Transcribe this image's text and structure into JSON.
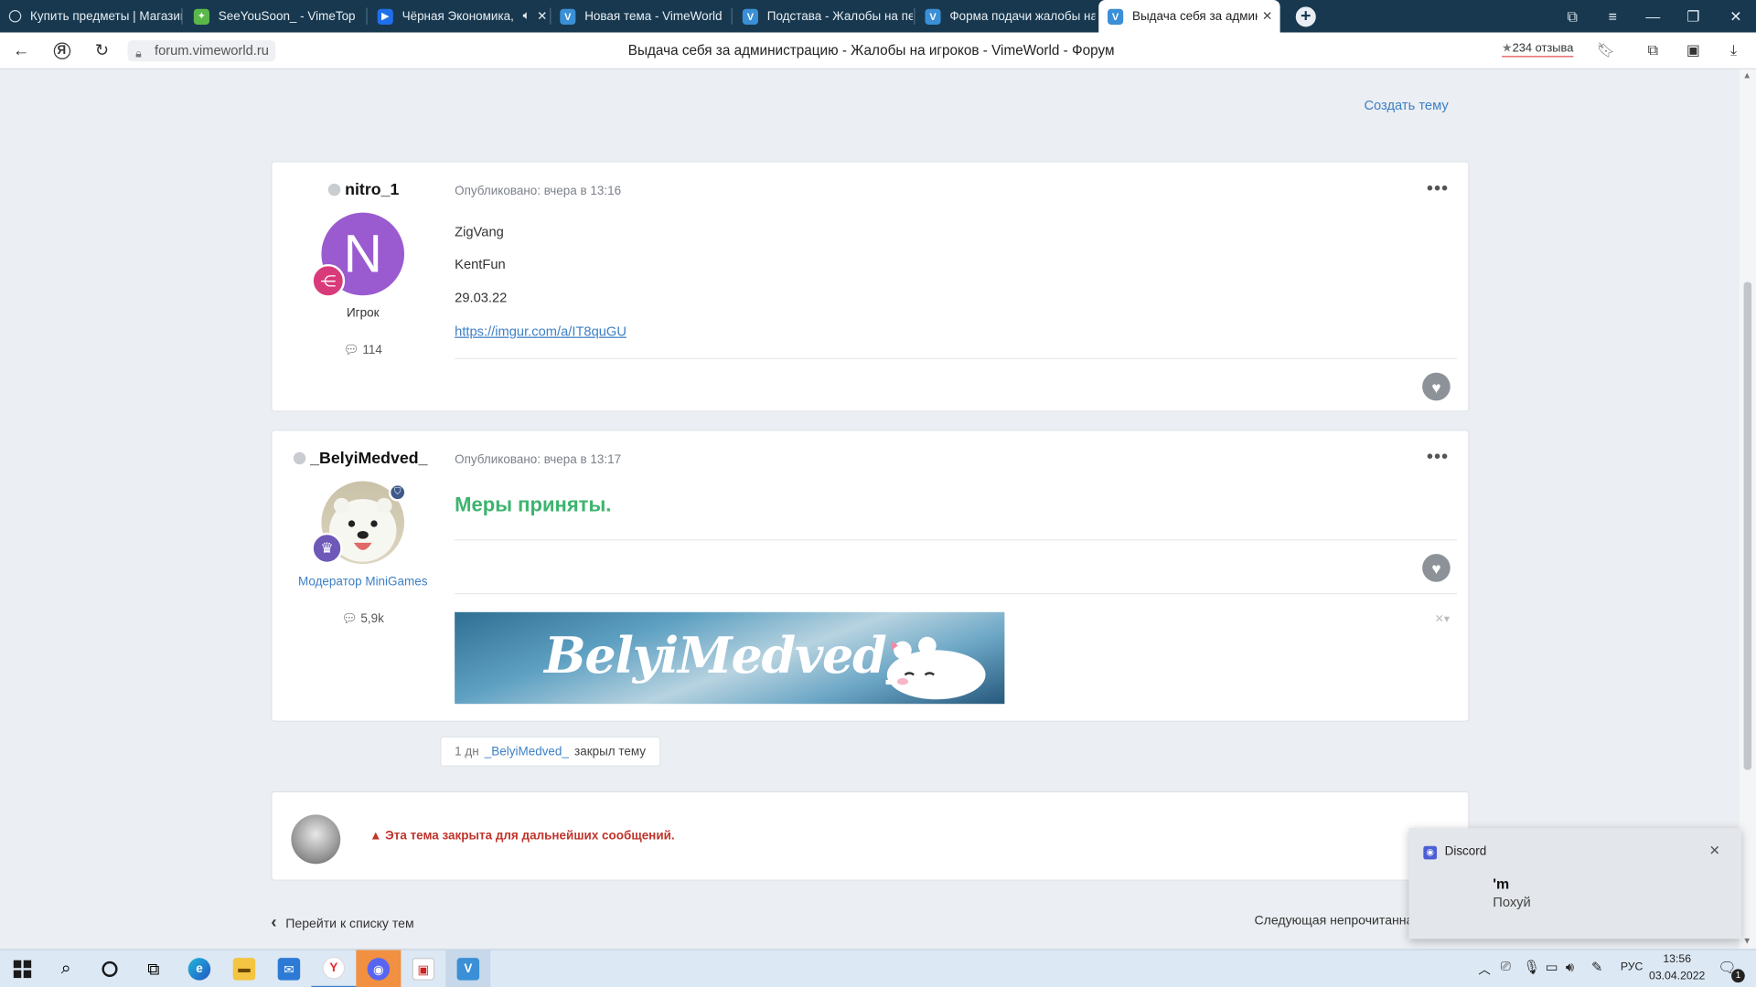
{
  "browser": {
    "tabs": [
      {
        "title": "Купить предметы | Магазин",
        "icon": "shop-icon",
        "color": "#2a4b63"
      },
      {
        "title": "SeeYouSoon_ - VimeTop",
        "icon": "vimetop-icon",
        "color": "#5ab84a"
      },
      {
        "title": "Чёрная Экономика,",
        "icon": "video-icon",
        "color": "#1f6feb"
      },
      {
        "title": "Новая тема - VimeWorld",
        "icon": "vimeworld-icon",
        "color": "#3a8fd6"
      },
      {
        "title": "Подстава - Жалобы на пе",
        "icon": "vimeworld-icon",
        "color": "#3a8fd6"
      },
      {
        "title": "Форма подачи жалобы на",
        "icon": "vimeworld-icon",
        "color": "#3a8fd6"
      },
      {
        "title": "Выдача себя за админи",
        "icon": "vimeworld-icon",
        "color": "#3a8fd6"
      }
    ],
    "url": "forum.vimeworld.ru",
    "page_title": "Выдача себя за администрацию - Жалобы на игроков - VimeWorld - Форум",
    "reviews": "234 отзыва"
  },
  "forum": {
    "create_topic": "Создать тему",
    "posts": [
      {
        "author": "nitro_1",
        "avatar_letter": "N",
        "avatar_color": "#9a5bd0",
        "rank": "Игрок",
        "post_count": "114",
        "posted": "Опубликовано: вчера в 13:16",
        "lines": [
          "ZigVang",
          "KentFun",
          "29.03.22"
        ],
        "link": "https://imgur.com/a/IT8quGU"
      },
      {
        "author": "_BelyiMedved_",
        "rank": "Модератор MiniGames",
        "post_count": "5,9k",
        "posted": "Опубликовано: вчера в 13:17",
        "message": "Меры приняты.",
        "signature_text": "BelyiMedved_"
      }
    ],
    "event": {
      "time": "1 дн",
      "user": "_BelyiMedved_",
      "action": "закрыл тему"
    },
    "locked_notice": "Эта тема закрыта для дальнейших сообщений.",
    "back_link": "Перейти к списку тем",
    "next_link": "Следующая непрочитанна"
  },
  "notification": {
    "app": "Discord",
    "title": "'m",
    "body": "Похуй"
  },
  "taskbar": {
    "language": "РУС",
    "time": "13:56",
    "date": "03.04.2022",
    "notif_count": "1"
  }
}
